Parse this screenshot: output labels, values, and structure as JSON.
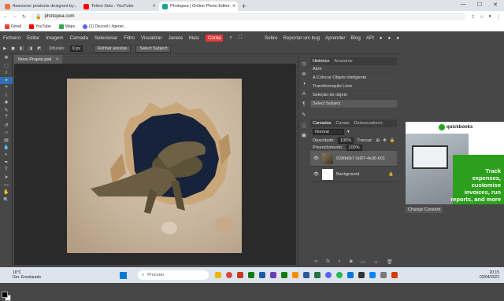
{
  "browser": {
    "tabs": [
      {
        "label": "Awesome products designed by...",
        "color": "#e8743b"
      },
      {
        "label": "Telmo Sela - YouTube",
        "color": "#ff0000"
      },
      {
        "label": "Photopea | Online Photo Editor",
        "color": "#18a497"
      }
    ],
    "url": "photopea.com",
    "bookmarks": [
      "Gmail",
      "YouTube",
      "Maps",
      "(1) Discord | #gener..."
    ]
  },
  "menu": {
    "items": [
      "Ficheiro",
      "Editar",
      "Imagem",
      "Camada",
      "Selecionar",
      "Filtro",
      "Visualizar",
      "Janela",
      "Mais"
    ],
    "account": "Conta",
    "right": [
      "Sobre",
      "Reportar um bug",
      "Aprender",
      "Blog",
      "API"
    ]
  },
  "options": {
    "diffusion_label": "Difusão:",
    "diffusion_value": "0 px",
    "refine": "Refinar arestas",
    "select_subject": "Select Subject"
  },
  "document": {
    "tab": "Novo Projeto.psd",
    "close": "×"
  },
  "history": {
    "tabs": [
      "Histórico",
      "Amostras"
    ],
    "items": [
      "Abrir",
      "A Colocar Objeto inteligente",
      "Transformação Livre",
      "Seleção de objeto",
      "Select Subject"
    ]
  },
  "layers": {
    "tabs": [
      "Camadas",
      "Canais",
      "Demarcadores"
    ],
    "blend": "Normal",
    "opacity_label": "Opacidade:",
    "opacity": "100%",
    "lock_label": "Trancar:",
    "fill_label": "Preenchimento:",
    "fill": "100%",
    "items": [
      {
        "name": "028fb6b7-9d97-4e36-b01",
        "selected": true
      },
      {
        "name": "Background",
        "selected": false
      }
    ]
  },
  "ad": {
    "brand": "quickbooks",
    "text": [
      "Track",
      "expenses,",
      "customise",
      "invoices, run",
      "reports, and more"
    ],
    "consent": "Change Consent"
  },
  "taskbar": {
    "temp": "16°C",
    "weather": "Ger. Ensolarado",
    "search": "Procurar",
    "time": "20:15",
    "date": "02/04/2023"
  }
}
